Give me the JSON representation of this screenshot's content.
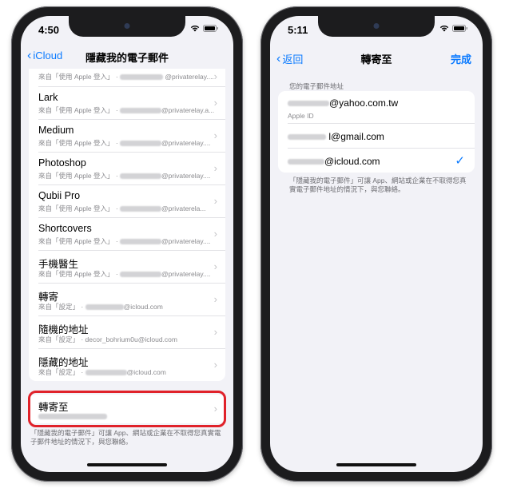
{
  "left": {
    "time": "4:50",
    "nav": {
      "back_label": "iCloud",
      "title": "隱藏我的電子郵件"
    },
    "top_partial_row": {
      "subtitle_prefix": "來自「使用 Apple 登入」 ·",
      "subtitle_suffix": "@privaterelay...."
    },
    "items": [
      {
        "title": "Lark",
        "subtitle_prefix": "來自「使用 Apple 登入」 ·",
        "subtitle_suffix": "@privaterelay.a..."
      },
      {
        "title": "Medium",
        "subtitle_prefix": "來自「使用 Apple 登入」 ·",
        "subtitle_suffix": "@privaterelay...."
      },
      {
        "title": "Photoshop",
        "subtitle_prefix": "來自「使用 Apple 登入」 ·",
        "subtitle_suffix": "@privaterelay...."
      },
      {
        "title": "Qubii Pro",
        "subtitle_prefix": "來自「使用 Apple 登入」 ·",
        "subtitle_suffix": "@privaterela..."
      },
      {
        "title": "Shortcovers",
        "subtitle_prefix": "來自「使用 Apple 登入」 ·",
        "subtitle_suffix": "@privaterelay...."
      },
      {
        "title": "手機醫生",
        "subtitle_prefix": "來自「使用 Apple 登入」 ·",
        "subtitle_suffix": "@privaterelay...."
      },
      {
        "title": "轉寄",
        "subtitle_prefix": "來自「設定」 ·",
        "subtitle_suffix": "@icloud.com"
      },
      {
        "title": "隨機的地址",
        "subtitle_prefix": "來自「設定」 · decor_bohrium0u@icloud.com",
        "subtitle_suffix": ""
      },
      {
        "title": "隱藏的地址",
        "subtitle_prefix": "來自「設定」 ·",
        "subtitle_suffix": "@icloud.com"
      }
    ],
    "forward": {
      "title": "轉寄至"
    },
    "footer": "「隱藏我的電子郵件」可讓 App、網站或企業在不取得您真實電子郵件地址的情況下，與您聯絡。"
  },
  "right": {
    "time": "5:11",
    "nav": {
      "back_label": "返回",
      "title": "轉寄至",
      "done_label": "完成"
    },
    "section_header": "您的電子郵件地址",
    "emails": [
      {
        "suffix": "@yahoo.com.tw",
        "sub": "Apple ID",
        "checked": false
      },
      {
        "suffix": "l@gmail.com",
        "sub": "",
        "checked": false
      },
      {
        "suffix": "@icloud.com",
        "sub": "",
        "checked": true
      }
    ],
    "checkmark": "✓",
    "footer": "「隱藏我的電子郵件」可讓 App、網站或企業在不取得您真實電子郵件地址的情況下，與您聯絡。"
  },
  "colors": {
    "accent": "#0a7aff",
    "highlight": "#e0222a"
  }
}
